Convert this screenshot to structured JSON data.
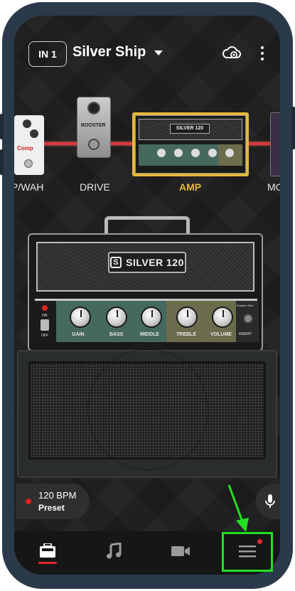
{
  "header": {
    "input_badge": "IN 1",
    "preset_name": "Silver Ship"
  },
  "signal_chain": {
    "items": [
      {
        "label": "P/WAH",
        "active": false
      },
      {
        "label": "DRIVE",
        "active": false
      },
      {
        "label": "AMP",
        "active": true
      },
      {
        "label": "MO",
        "active": false
      }
    ],
    "pedal_comp_text": "Comp",
    "pedal_booster_text": "BOOSTER",
    "mini_amp_logo": "SILVER 120"
  },
  "amp": {
    "logo": "SILVER 120",
    "logo_mark": "S",
    "switch_on": "ON",
    "switch_off": "OFF",
    "knobs": [
      "GAIN",
      "BASS",
      "MIDDLE",
      "TREBLE",
      "VOLUME"
    ],
    "right_panel_top": "Positive Grid",
    "right_panel_label": "INSERT"
  },
  "transport": {
    "bpm": "120 BPM",
    "mode": "Preset"
  },
  "tabs": [
    {
      "name": "amp-tab",
      "icon": "amp-icon",
      "active": true
    },
    {
      "name": "music-tab",
      "icon": "music-note-icon",
      "active": false
    },
    {
      "name": "video-tab",
      "icon": "video-camera-icon",
      "active": false
    },
    {
      "name": "menu-tab",
      "icon": "hamburger-menu-icon",
      "active": false,
      "has_notification": true
    }
  ],
  "colors": {
    "accent_active": "#e4b93a",
    "record_red": "#e02020",
    "wire_red": "#d93a3a",
    "highlight_green": "#22e022"
  }
}
